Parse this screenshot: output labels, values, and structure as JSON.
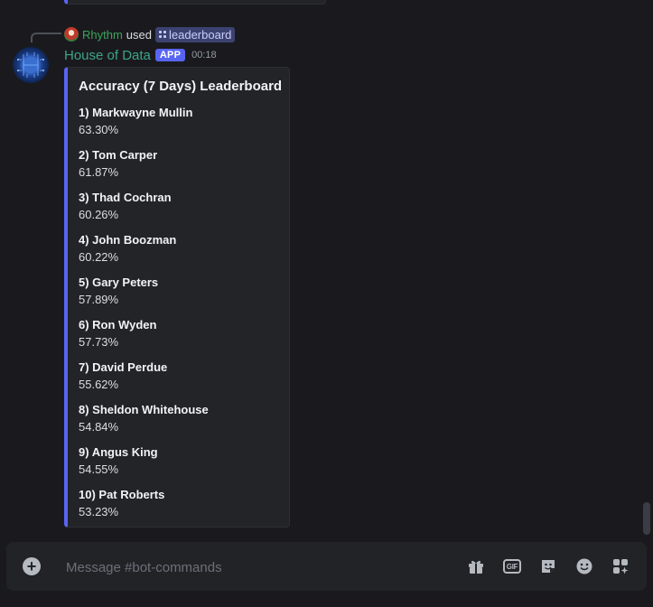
{
  "reply": {
    "author": "Rhythm",
    "verb": "used",
    "command": "leaderboard"
  },
  "message": {
    "author": "House of Data",
    "badge": "APP",
    "time": "00:18"
  },
  "embed": {
    "title": "Accuracy (7 Days) Leaderboard",
    "entries": [
      {
        "name": "1) Markwayne Mullin",
        "value": "63.30%"
      },
      {
        "name": "2) Tom Carper",
        "value": "61.87%"
      },
      {
        "name": "3) Thad Cochran",
        "value": "60.26%"
      },
      {
        "name": "4) John Boozman",
        "value": "60.22%"
      },
      {
        "name": "5) Gary Peters",
        "value": "57.89%"
      },
      {
        "name": "6) Ron Wyden",
        "value": "57.73%"
      },
      {
        "name": "7) David Perdue",
        "value": "55.62%"
      },
      {
        "name": "8) Sheldon Whitehouse",
        "value": "54.84%"
      },
      {
        "name": "9) Angus King",
        "value": "54.55%"
      },
      {
        "name": "10) Pat Roberts",
        "value": "53.23%"
      }
    ]
  },
  "composer": {
    "placeholder": "Message #bot-commands",
    "gif_label": "GIF",
    "icons": [
      "add-icon",
      "gift-icon",
      "gif-icon",
      "sticker-icon",
      "emoji-icon",
      "apps-icon"
    ]
  },
  "colors": {
    "accent": "#5865f2",
    "username": "#3ba58a",
    "reply_author": "#3ba55d",
    "background": "#1a1a1e"
  }
}
